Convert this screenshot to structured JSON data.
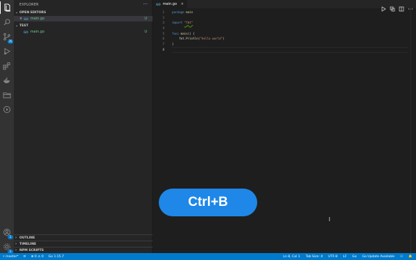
{
  "colors": {
    "accent": "#007acc",
    "modified_green": "#73c991",
    "go_blue": "#519aba",
    "shortcut_pill": "#1e87e8"
  },
  "activity_bar": {
    "icons": [
      "explorer-icon",
      "search-icon",
      "source-control-icon",
      "run-debug-icon",
      "extensions-icon",
      "docker-icon",
      "folder-icon",
      "timeline-play-icon",
      "account-icon",
      "settings-gear-icon"
    ],
    "source_control_badge": "35",
    "account_badge": "1",
    "settings_badge": "1"
  },
  "sidebar": {
    "title": "EXPLORER",
    "more_actions": "···",
    "open_editors": {
      "label": "OPEN EDITORS",
      "items": [
        {
          "close": "×",
          "icon": "go",
          "name": "main.go",
          "status": "U"
        }
      ]
    },
    "folder": {
      "label": "TEST",
      "items": [
        {
          "icon": "go",
          "name": "main.go",
          "status": "U"
        }
      ]
    },
    "bottom_sections": [
      "OUTLINE",
      "TIMELINE",
      "NPM SCRIPTS"
    ]
  },
  "editor": {
    "tab": {
      "icon": "go",
      "name": "main.go",
      "close": "×"
    },
    "line_numbers": [
      "1",
      "2",
      "3",
      "4",
      "5",
      "6",
      "7",
      "8"
    ],
    "lines": [
      [
        {
          "t": "package ",
          "c": "kw"
        },
        {
          "t": "main",
          "c": "id"
        }
      ],
      [],
      [
        {
          "t": "import ",
          "c": "kw"
        },
        {
          "t": "\"fmt\"",
          "c": "st-u"
        }
      ],
      [],
      [
        {
          "t": "func ",
          "c": "kw"
        },
        {
          "t": "main",
          "c": "id"
        },
        {
          "t": "() {",
          "c": "pl"
        }
      ],
      [
        {
          "t": "    fmt.",
          "c": "pl"
        },
        {
          "t": "Println",
          "c": "id"
        },
        {
          "t": "(",
          "c": "pl"
        },
        {
          "t": "\"hello world\"",
          "c": "st"
        },
        {
          "t": ")",
          "c": "pl"
        }
      ],
      [
        {
          "t": "}",
          "c": "pl"
        }
      ],
      []
    ],
    "current_line": 8
  },
  "overlay": {
    "shortcut": "Ctrl+B",
    "cursor_glyph": "I"
  },
  "statusbar": {
    "branch": "master*",
    "sync": "⟳",
    "problems": "⊗ 0 ⚠ 0",
    "go_version": "Go 1.15.7",
    "position": "Ln 8, Col 1",
    "tab_size": "Tab Size: 4",
    "encoding": "UTF-8",
    "eol": "LF",
    "language": "Go",
    "go_update": "Go Update Available",
    "live_share": "⚇",
    "notifications": "🔔"
  }
}
